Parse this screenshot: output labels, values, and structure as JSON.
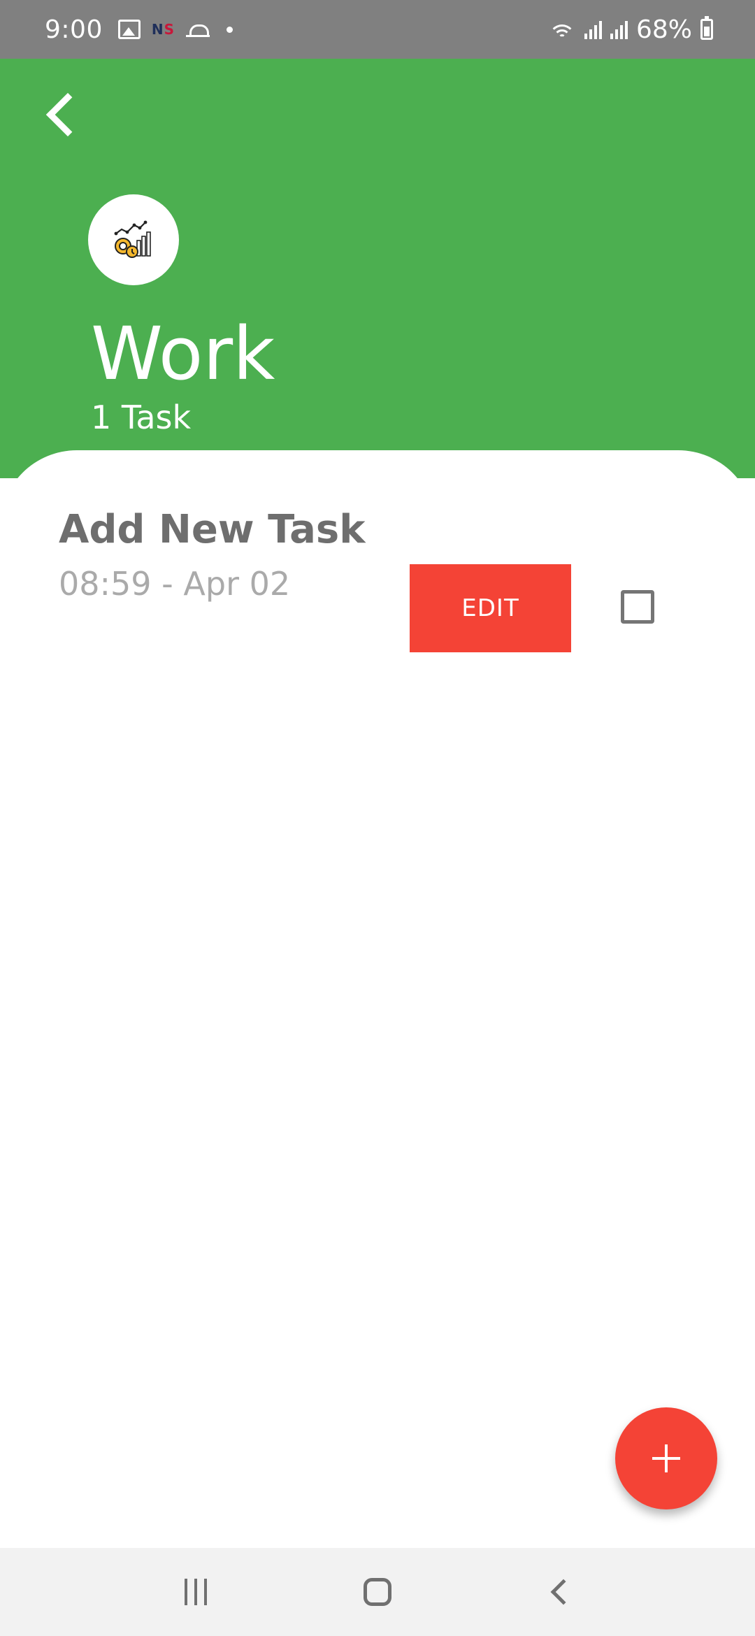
{
  "status_bar": {
    "time": "9:00",
    "notification_badge": {
      "first": "N",
      "second": "S"
    },
    "battery_percent": "68%"
  },
  "header": {
    "category_icon": "work-gears-chart-icon",
    "title": "Work",
    "task_count": "1 Task",
    "background_color": "#4caf50"
  },
  "tasks": [
    {
      "title": "Add New Task",
      "meta": "08:59 - Apr 02",
      "edit_label": "EDIT",
      "checked": false
    }
  ],
  "fab": {
    "icon": "plus-icon",
    "color": "#f44336"
  },
  "nav_bar": {
    "buttons": [
      "recents",
      "home",
      "back"
    ]
  }
}
